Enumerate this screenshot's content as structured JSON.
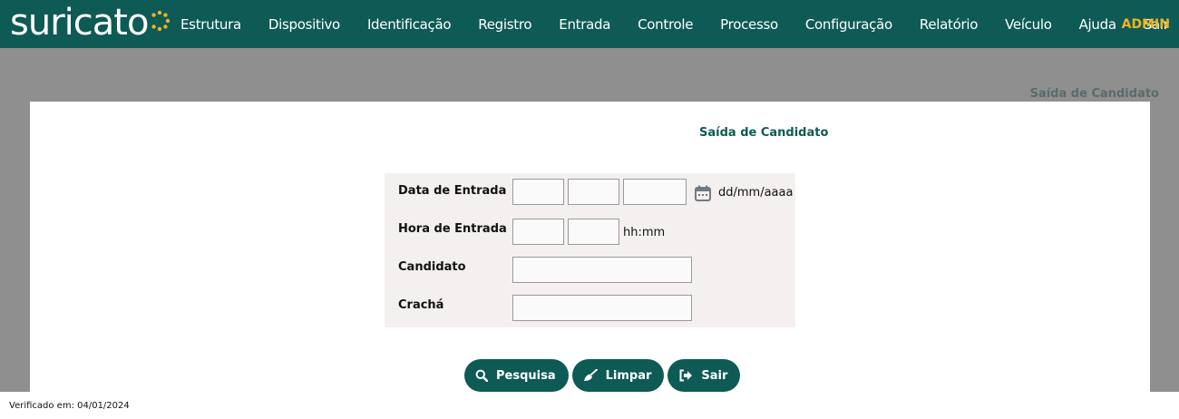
{
  "brand": {
    "name": "suricato",
    "accent": "#f0b323",
    "primary": "#0e5a55"
  },
  "nav": {
    "items": [
      "Estrutura",
      "Dispositivo",
      "Identificação",
      "Registro",
      "Entrada",
      "Controle",
      "Processo",
      "Configuração",
      "Relatório",
      "Veículo",
      "Ajuda",
      "Sair"
    ],
    "user": "ADMIN"
  },
  "page": {
    "crumb": "Saída de Candidato",
    "title": "Saída de Candidato"
  },
  "form": {
    "date": {
      "label": "Data de Entrada",
      "day": "",
      "month": "",
      "year": "",
      "hint": "dd/mm/aaaa",
      "icon": "calendar-icon"
    },
    "time": {
      "label": "Hora de Entrada",
      "hour": "",
      "minute": "",
      "hint": "hh:mm"
    },
    "candidate": {
      "label": "Candidato",
      "value": ""
    },
    "badge": {
      "label": "Crachá",
      "value": ""
    }
  },
  "buttons": {
    "search": {
      "label": "Pesquisa",
      "icon": "search-icon"
    },
    "clear": {
      "label": "Limpar",
      "icon": "broom-icon"
    },
    "exit": {
      "label": "Sair",
      "icon": "sign-out-icon"
    }
  },
  "footer": {
    "verified": "Verificado em: 04/01/2024"
  }
}
